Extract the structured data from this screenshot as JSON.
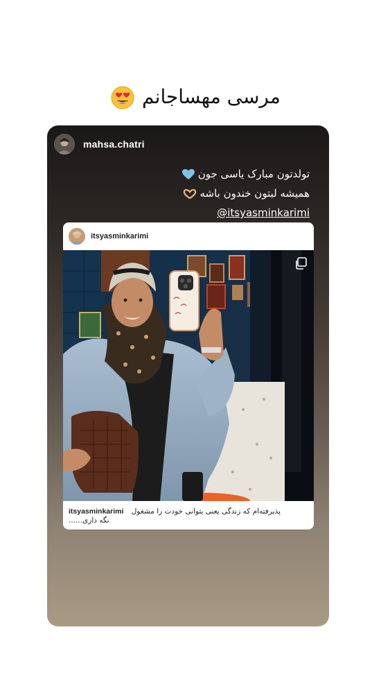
{
  "top_caption": {
    "text": "مرسی مهساجانم",
    "emoji_icon": "heart-eyes-emoji-icon"
  },
  "story": {
    "author": {
      "username": "mahsa.chatri",
      "avatar_icon": "user-avatar-icon"
    },
    "greeting": {
      "line1": "تولدتون مبارک یاسی جون",
      "line1_icon": "light-blue-heart-icon",
      "line2": "همیشه لبتون خندون باشه",
      "line2_icon": "heart-hands-icon",
      "mention": "@itsyasminkarimi"
    },
    "shared_post": {
      "username": "itsyasminkarimi",
      "avatar_icon": "user-avatar-icon",
      "carousel_icon": "multiple-photos-icon",
      "caption": {
        "username": "itsyasminkarimi",
        "line1": "پذیرفته‌ام که زندگی یعنی بتوانی خودت را مشغول",
        "line2": "نگه داری......"
      }
    }
  },
  "colors": {
    "card_top": "#1a1818",
    "card_bottom": "#a99a84",
    "heart_blue": "#7cc3e8"
  }
}
